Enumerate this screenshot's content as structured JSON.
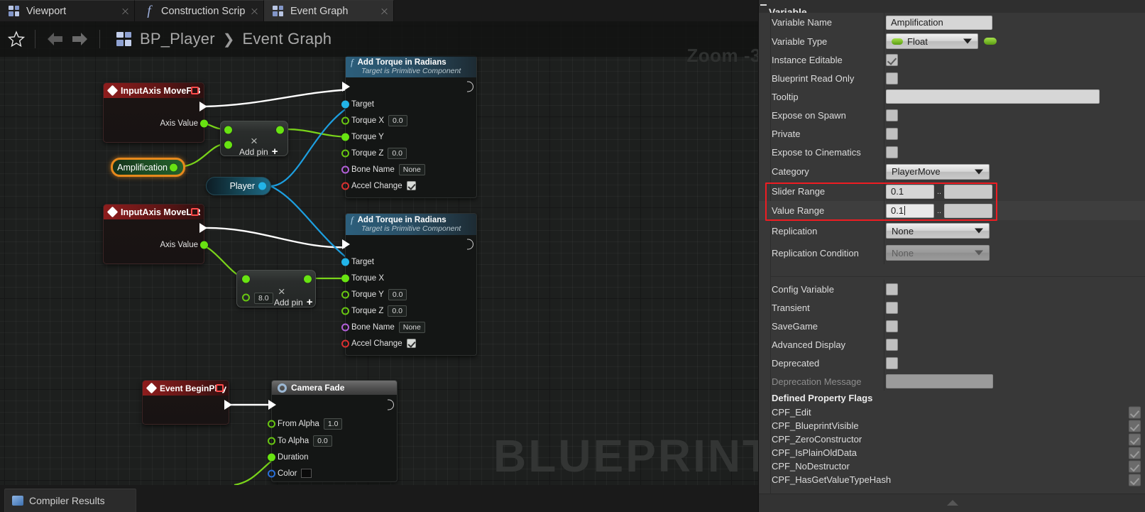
{
  "tabs": [
    {
      "label": "Viewport",
      "icon": "blueprint-grid-icon",
      "active": false
    },
    {
      "label": "Construction Scrip",
      "icon": "function-fx-icon",
      "active": false
    },
    {
      "label": "Event Graph",
      "icon": "blueprint-grid-icon",
      "active": true
    }
  ],
  "graph_toolbar": {
    "star_icon": "star-icon",
    "back_icon": "arrow-left-icon",
    "forward_icon": "arrow-right-icon",
    "breadcrumb_root": "BP_Player",
    "breadcrumb_sep": "❯",
    "breadcrumb_current": "Event Graph",
    "zoom_label": "Zoom -3",
    "watermark": "BLUEPRINT"
  },
  "bottom_tab": {
    "label": "Compiler Results",
    "icon": "compiler-icon"
  },
  "graph": {
    "nodes": [
      {
        "id": "input_move_fb",
        "type": "event",
        "title": "InputAxis MoveF/B",
        "pins_out": [
          {
            "label": "",
            "kind": "exec"
          },
          {
            "label": "Axis Value",
            "kind": "float"
          }
        ]
      },
      {
        "id": "input_move_lr",
        "type": "event",
        "title": "InputAxis MoveL/R",
        "pins_out": [
          {
            "label": "",
            "kind": "exec"
          },
          {
            "label": "Axis Value",
            "kind": "float"
          }
        ]
      },
      {
        "id": "amplification_get",
        "type": "variable-get",
        "title": "Amplification",
        "selected": true
      },
      {
        "id": "player_get",
        "type": "variable-get-object",
        "title": "Player"
      },
      {
        "id": "multiply_top",
        "type": "multiply",
        "operator": "×",
        "add_pin_label": "Add pin",
        "inputs": [
          "",
          ""
        ]
      },
      {
        "id": "multiply_bottom",
        "type": "multiply",
        "operator": "×",
        "add_pin_label": "Add pin",
        "inputs": [
          "",
          "8.0"
        ]
      },
      {
        "id": "add_torque_top",
        "type": "function",
        "title": "Add Torque in Radians",
        "subtitle": "Target is Primitive Component",
        "rows": [
          {
            "label": "Target",
            "kind": "object",
            "value": null
          },
          {
            "label": "Torque X",
            "kind": "float",
            "value": "0.0"
          },
          {
            "label": "Torque Y",
            "kind": "float-connected",
            "value": null
          },
          {
            "label": "Torque Z",
            "kind": "float",
            "value": "0.0"
          },
          {
            "label": "Bone Name",
            "kind": "name",
            "value": "None"
          },
          {
            "label": "Accel Change",
            "kind": "bool",
            "value": true
          }
        ]
      },
      {
        "id": "add_torque_bottom",
        "type": "function",
        "title": "Add Torque in Radians",
        "subtitle": "Target is Primitive Component",
        "rows": [
          {
            "label": "Target",
            "kind": "object",
            "value": null
          },
          {
            "label": "Torque X",
            "kind": "float-connected",
            "value": null
          },
          {
            "label": "Torque Y",
            "kind": "float",
            "value": "0.0"
          },
          {
            "label": "Torque Z",
            "kind": "float",
            "value": "0.0"
          },
          {
            "label": "Bone Name",
            "kind": "name",
            "value": "None"
          },
          {
            "label": "Accel Change",
            "kind": "bool",
            "value": true
          }
        ]
      },
      {
        "id": "event_begin_play",
        "type": "event",
        "title": "Event BeginPlay"
      },
      {
        "id": "camera_fade",
        "type": "grey-function",
        "title": "Camera Fade",
        "rows": [
          {
            "label": "From Alpha",
            "kind": "float",
            "value": "1.0"
          },
          {
            "label": "To Alpha",
            "kind": "float",
            "value": "0.0"
          },
          {
            "label": "Duration",
            "kind": "float-connected",
            "value": null
          },
          {
            "label": "Color",
            "kind": "color",
            "value": "#0a0a0a"
          }
        ]
      }
    ]
  },
  "details": {
    "section_title": "Variable",
    "rows": [
      {
        "label": "Variable Name",
        "control": "text",
        "value": "Amplification"
      },
      {
        "label": "Variable Type",
        "control": "combo-type",
        "value": "Float"
      },
      {
        "label": "Instance Editable",
        "control": "checkbox",
        "value": true
      },
      {
        "label": "Blueprint Read Only",
        "control": "checkbox",
        "value": false
      },
      {
        "label": "Tooltip",
        "control": "text-wide",
        "value": ""
      },
      {
        "label": "Expose on Spawn",
        "control": "checkbox",
        "value": false
      },
      {
        "label": "Private",
        "control": "checkbox",
        "value": false
      },
      {
        "label": "Expose to Cinematics",
        "control": "checkbox",
        "value": false
      },
      {
        "label": "Category",
        "control": "combo",
        "value": "PlayerMove"
      },
      {
        "label": "Slider Range",
        "control": "range",
        "value_min": "0.1",
        "value_max": "",
        "highlighted": true
      },
      {
        "label": "Value Range",
        "control": "range",
        "value_min": "0.1",
        "value_max": "",
        "highlighted": true,
        "focused": true
      },
      {
        "label": "Replication",
        "control": "combo",
        "value": "None"
      },
      {
        "label": "Replication Condition",
        "control": "combo-disabled",
        "value": "None"
      }
    ],
    "rows2": [
      {
        "label": "Config Variable",
        "control": "checkbox",
        "value": false
      },
      {
        "label": "Transient",
        "control": "checkbox",
        "value": false
      },
      {
        "label": "SaveGame",
        "control": "checkbox",
        "value": false
      },
      {
        "label": "Advanced Display",
        "control": "checkbox",
        "value": false
      },
      {
        "label": "Deprecated",
        "control": "checkbox",
        "value": false
      },
      {
        "label": "Deprecation Message",
        "control": "text-gray",
        "value": "",
        "disabled": true
      }
    ],
    "flags_title": "Defined Property Flags",
    "flags": [
      {
        "label": "CPF_Edit",
        "value": true
      },
      {
        "label": "CPF_BlueprintVisible",
        "value": true
      },
      {
        "label": "CPF_ZeroConstructor",
        "value": true
      },
      {
        "label": "CPF_IsPlainOldData",
        "value": true
      },
      {
        "label": "CPF_NoDestructor",
        "value": true
      },
      {
        "label": "CPF_HasGetValueTypeHash",
        "value": true
      }
    ],
    "range_separator": ".."
  },
  "colors": {
    "highlight": "#ee1c22",
    "exec_wire": "#ffffff",
    "float_wire": "#7ad41a",
    "object_wire": "#1d9fe0",
    "selected_node": "#e8891c"
  }
}
